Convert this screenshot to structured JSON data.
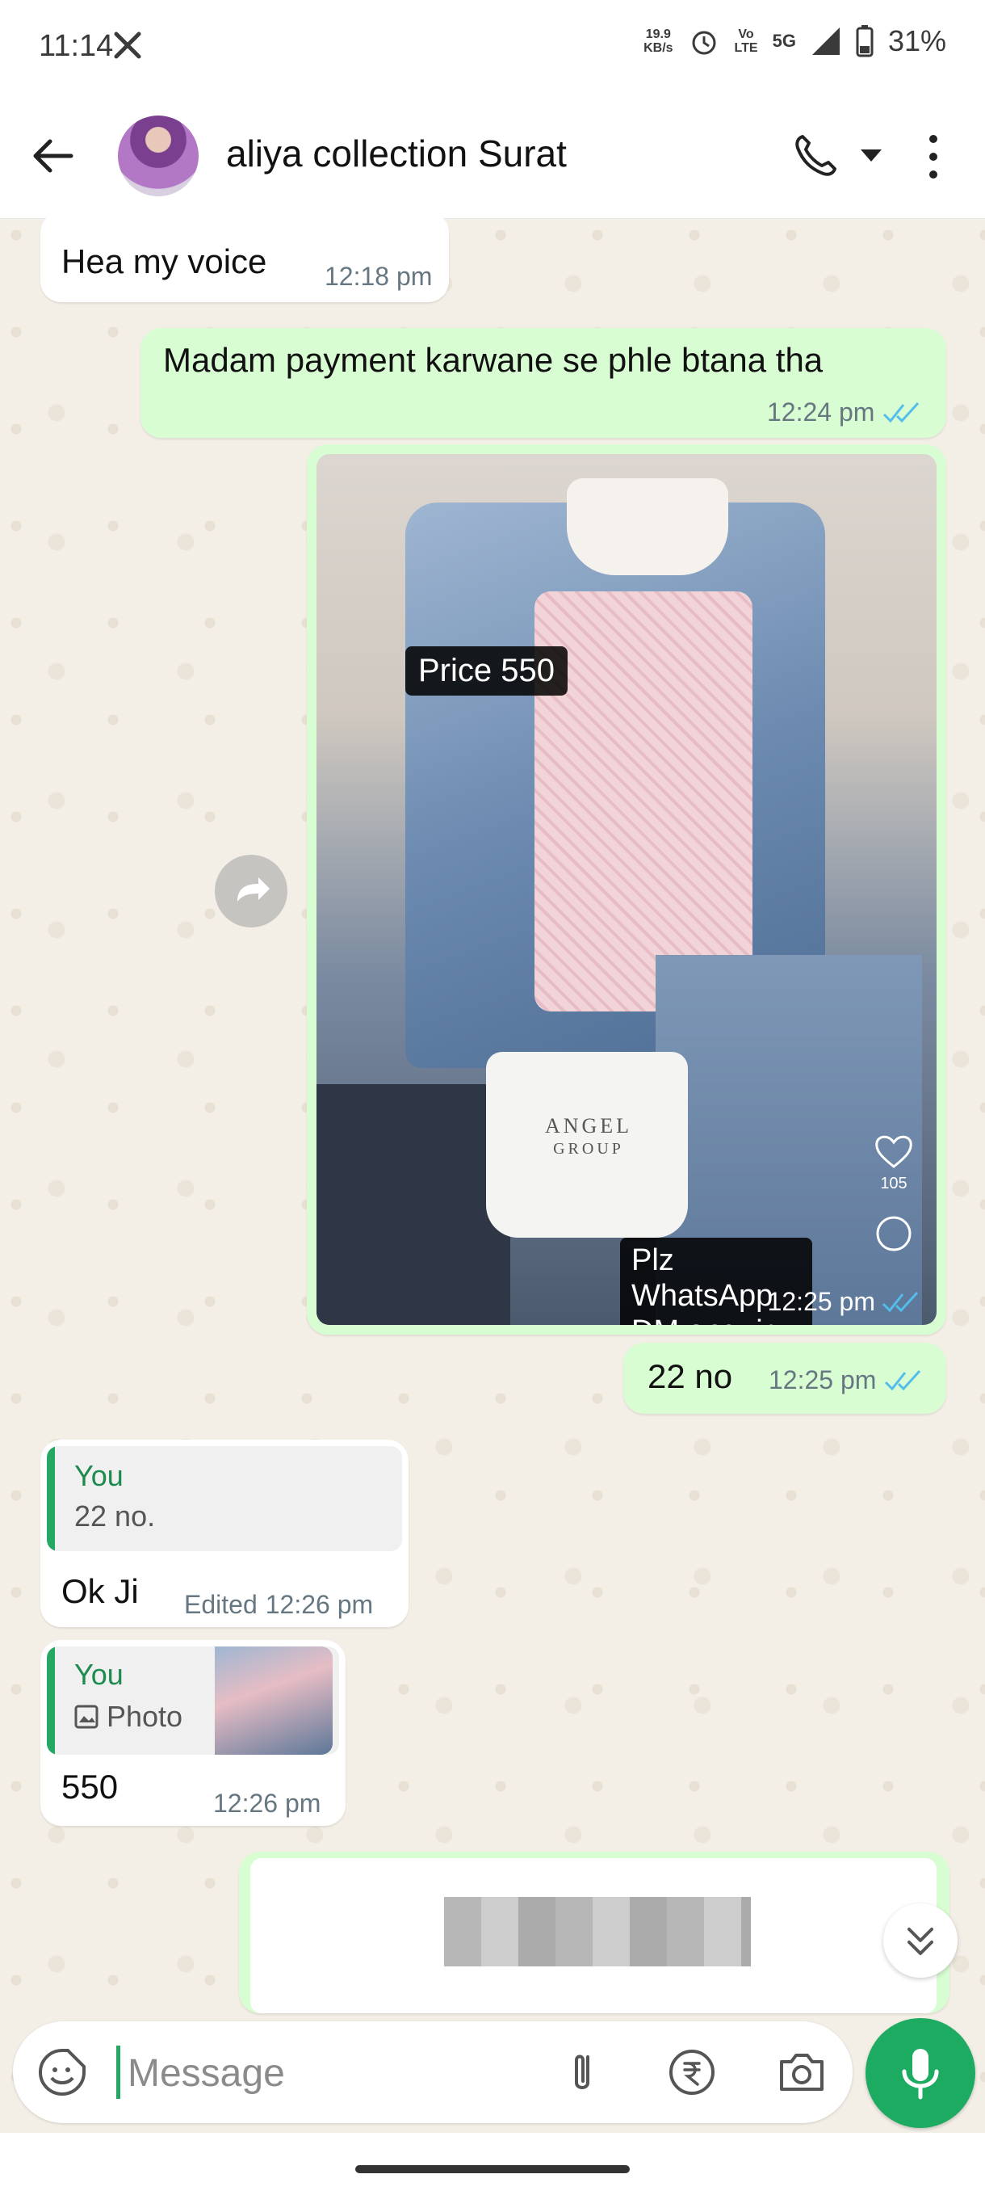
{
  "status_bar": {
    "time": "11:14",
    "speed_value": "19.9",
    "speed_unit": "KB/s",
    "volte_top": "Vo",
    "volte_bottom": "LTE",
    "network": "5G",
    "battery": "31%"
  },
  "header": {
    "contact_name": "aliya collection Surat"
  },
  "messages": [
    {
      "id": "m1",
      "direction": "incoming",
      "text": "Hea my voice",
      "time": "12:18 pm"
    },
    {
      "id": "m2",
      "direction": "outgoing",
      "text": "Madam payment karwane se phle btana tha",
      "time": "12:24 pm",
      "status": "read"
    },
    {
      "id": "m3",
      "direction": "outgoing",
      "type": "photo",
      "overlay_price": "Price 550",
      "overlay_brand_1": "ANGEL",
      "overlay_brand_2": "GROUP",
      "overlay_wa_1": "Plz WhatsApp",
      "overlay_wa_2": "DM enquiry",
      "likes": "105",
      "time": "12:25 pm",
      "status": "read"
    },
    {
      "id": "m4",
      "direction": "outgoing",
      "text": "22 no",
      "time": "12:25 pm",
      "status": "read"
    },
    {
      "id": "m5",
      "direction": "incoming",
      "quote_author": "You",
      "quote_text": "22 no.",
      "text": "Ok Ji",
      "edited_label": "Edited",
      "time": "12:26 pm"
    },
    {
      "id": "m6",
      "direction": "incoming",
      "quote_author": "You",
      "quote_text": "Photo",
      "text": "550",
      "time": "12:26 pm"
    }
  ],
  "composer": {
    "placeholder": "Message"
  },
  "colors": {
    "outgoing_bubble": "#d9fdd3",
    "incoming_bubble": "#ffffff",
    "accent_green": "#1daa61",
    "read_tick": "#53bdeb",
    "chat_background": "#f3efe7"
  }
}
